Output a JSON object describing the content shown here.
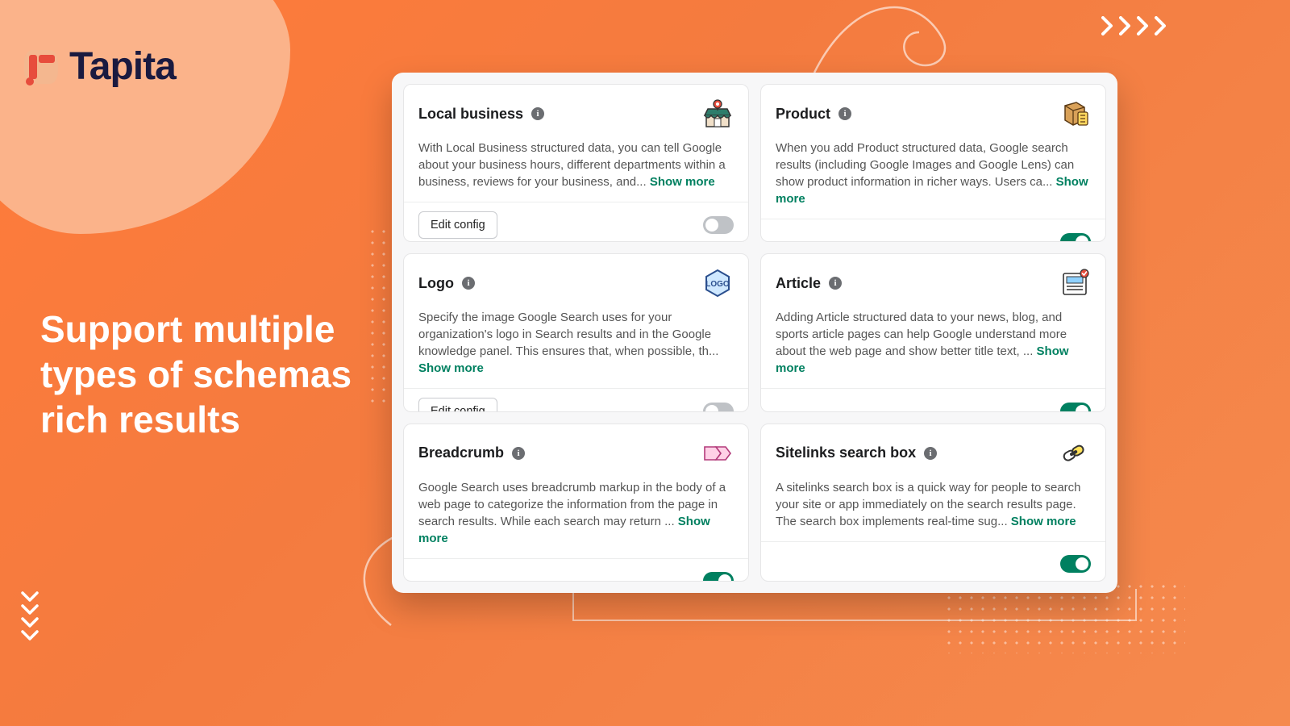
{
  "brand": {
    "name": "Tapita"
  },
  "headline": "Support multiple types of schemas rich results",
  "labels": {
    "show_more": "Show more",
    "edit_config": "Edit config"
  },
  "cards": [
    {
      "title": "Local business",
      "desc": "With Local Business structured data, you can tell Google about your business hours, different departments within a business, reviews for your business, and... ",
      "has_edit": true,
      "toggle": false,
      "icon_key": "local-business"
    },
    {
      "title": "Product",
      "desc": "When you add Product structured data, Google search results (including Google Images and Google Lens) can show product information in richer ways. Users ca... ",
      "has_edit": false,
      "toggle": true,
      "icon_key": "product"
    },
    {
      "title": "Logo",
      "desc": "Specify the image Google Search uses for your organization's logo in Search results and in the Google knowledge panel. This ensures that, when possible, th... ",
      "has_edit": true,
      "toggle": false,
      "icon_key": "logo"
    },
    {
      "title": "Article",
      "desc": "Adding Article structured data to your news, blog, and sports article pages can help Google understand more about the web page and show better title text, ... ",
      "has_edit": false,
      "toggle": true,
      "icon_key": "article"
    },
    {
      "title": "Breadcrumb",
      "desc": "Google Search uses breadcrumb markup in the body of a web page to categorize the information from the page in search results. While each search may return ... ",
      "has_edit": false,
      "toggle": true,
      "icon_key": "breadcrumb"
    },
    {
      "title": "Sitelinks search box",
      "desc": "A sitelinks search box is a quick way for people to search your site or app immediately on the search results page. The search box implements real-time sug... ",
      "has_edit": false,
      "toggle": true,
      "icon_key": "sitelinks"
    }
  ]
}
